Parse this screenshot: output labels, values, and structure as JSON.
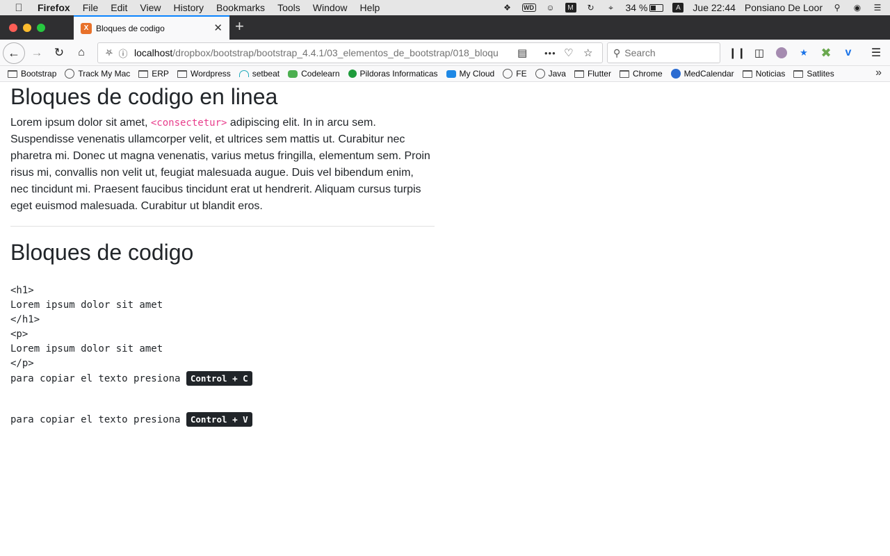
{
  "menubar": {
    "apple": "",
    "items": [
      "Firefox",
      "File",
      "Edit",
      "View",
      "History",
      "Bookmarks",
      "Tools",
      "Window",
      "Help"
    ],
    "battery": "34 %",
    "input_source": "A",
    "clock": "Jue 22:44",
    "user": "Ponsiano De Loor",
    "wd_label": "WD",
    "m_label": "M"
  },
  "tab": {
    "title": "Bloques de codigo",
    "favicon": "X"
  },
  "navbar": {
    "url_host": "localhost",
    "url_path": "/dropbox/bootstrap/bootstrap_4.4.1/03_elementos_de_bootstrap/018_bloqu",
    "search_placeholder": "Search"
  },
  "bookmarks": [
    {
      "label": "Bootstrap",
      "icon": "folder"
    },
    {
      "label": "Track My Mac",
      "icon": "globe"
    },
    {
      "label": "ERP",
      "icon": "folder"
    },
    {
      "label": "Wordpress",
      "icon": "folder"
    },
    {
      "label": "setbeat",
      "icon": "teal"
    },
    {
      "label": "Codelearn",
      "icon": "green"
    },
    {
      "label": "Pildoras Informaticas",
      "icon": "gdot"
    },
    {
      "label": "My Cloud",
      "icon": "blue"
    },
    {
      "label": "FE",
      "icon": "globe"
    },
    {
      "label": "Java",
      "icon": "globe"
    },
    {
      "label": "Flutter",
      "icon": "folder"
    },
    {
      "label": "Chrome",
      "icon": "folder"
    },
    {
      "label": "MedCalendar",
      "icon": "med"
    },
    {
      "label": "Noticias",
      "icon": "folder"
    },
    {
      "label": "Satlites",
      "icon": "folder"
    }
  ],
  "page": {
    "heading1": "Bloques de codigo en linea",
    "para_before": "Lorem ipsum dolor sit amet, ",
    "inline_code": "<consectetur>",
    "para_after": " adipiscing elit. In in arcu sem. Suspendisse venenatis ullamcorper velit, et ultrices sem mattis ut. Curabitur nec pharetra mi. Donec ut magna venenatis, varius metus fringilla, elementum sem. Proin risus mi, convallis non velit ut, feugiat malesuada augue. Duis vel bibendum enim, nec tincidunt mi. Praesent faucibus tincidunt erat ut hendrerit. Aliquam cursus turpis eget euismod malesuada. Curabitur ut blandit eros.",
    "heading2": "Bloques de codigo",
    "pre_lines": [
      "<h1>",
      "Lorem ipsum dolor sit amet",
      "</h1>",
      "<p>",
      "Lorem ipsum dolor sit amet",
      "</p>"
    ],
    "copy_text": "para copiar el texto presiona ",
    "copy_kbd": "Control + C",
    "paste_text": "para copiar el texto presiona ",
    "paste_kbd": "Control + V"
  }
}
